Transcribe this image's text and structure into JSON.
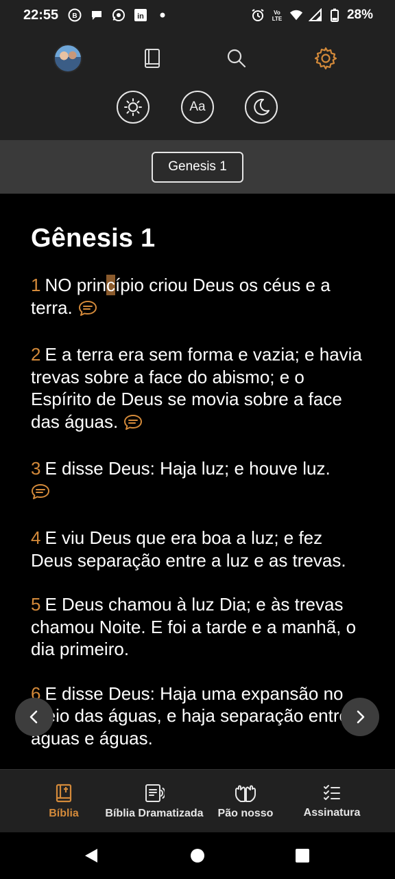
{
  "status_bar": {
    "time": "22:55",
    "left_icons": [
      "b-icon",
      "chat-icon",
      "whatsapp-icon",
      "linkedin-icon",
      "dot-icon"
    ],
    "right_icons": [
      "alarm-icon",
      "volte-icon",
      "wifi-icon",
      "signal-icon",
      "battery-icon"
    ],
    "battery": "28%"
  },
  "toolbar": {
    "icons": [
      "avatar",
      "book-icon",
      "search-icon",
      "settings-icon"
    ],
    "font_button_label": "Aa",
    "accent_color": "#d48a3a"
  },
  "chapter_selector": {
    "label": "Genesis 1"
  },
  "reader": {
    "title": "Gênesis 1",
    "verses": [
      {
        "num": "1",
        "before": "NO prin",
        "highlight": "c",
        "after": "ípio criou Deus os céus e a terra.",
        "has_comment": true
      },
      {
        "num": "2",
        "text": "E a terra era sem forma e vazia; e havia trevas sobre a face do abismo; e o Espírito de Deus se movia sobre a face das águas.",
        "has_comment": true
      },
      {
        "num": "3",
        "text": "E disse Deus: Haja luz; e houve luz.",
        "has_comment": true
      },
      {
        "num": "4",
        "text": "E viu Deus que era boa a luz; e fez Deus separação entre a luz e as trevas.",
        "has_comment": false
      },
      {
        "num": "5",
        "text": "E Deus chamou à luz Dia; e às trevas chamou Noite. E foi a tarde e a manhã, o dia primeiro.",
        "has_comment": false
      },
      {
        "num": "6",
        "text": "E disse Deus: Haja uma expansão no meio das águas, e haja separação entre águas e águas.",
        "has_comment": false
      }
    ]
  },
  "tabs": [
    {
      "label": "Bíblia",
      "icon": "bible-icon",
      "active": true
    },
    {
      "label": "Bíblia Dramatizada",
      "icon": "audio-book-icon",
      "active": false
    },
    {
      "label": "Pão nosso",
      "icon": "praying-hands-icon",
      "active": false
    },
    {
      "label": "Assinatura",
      "icon": "checklist-icon",
      "active": false
    }
  ],
  "system_nav": [
    "back-icon",
    "home-icon",
    "recents-icon"
  ]
}
